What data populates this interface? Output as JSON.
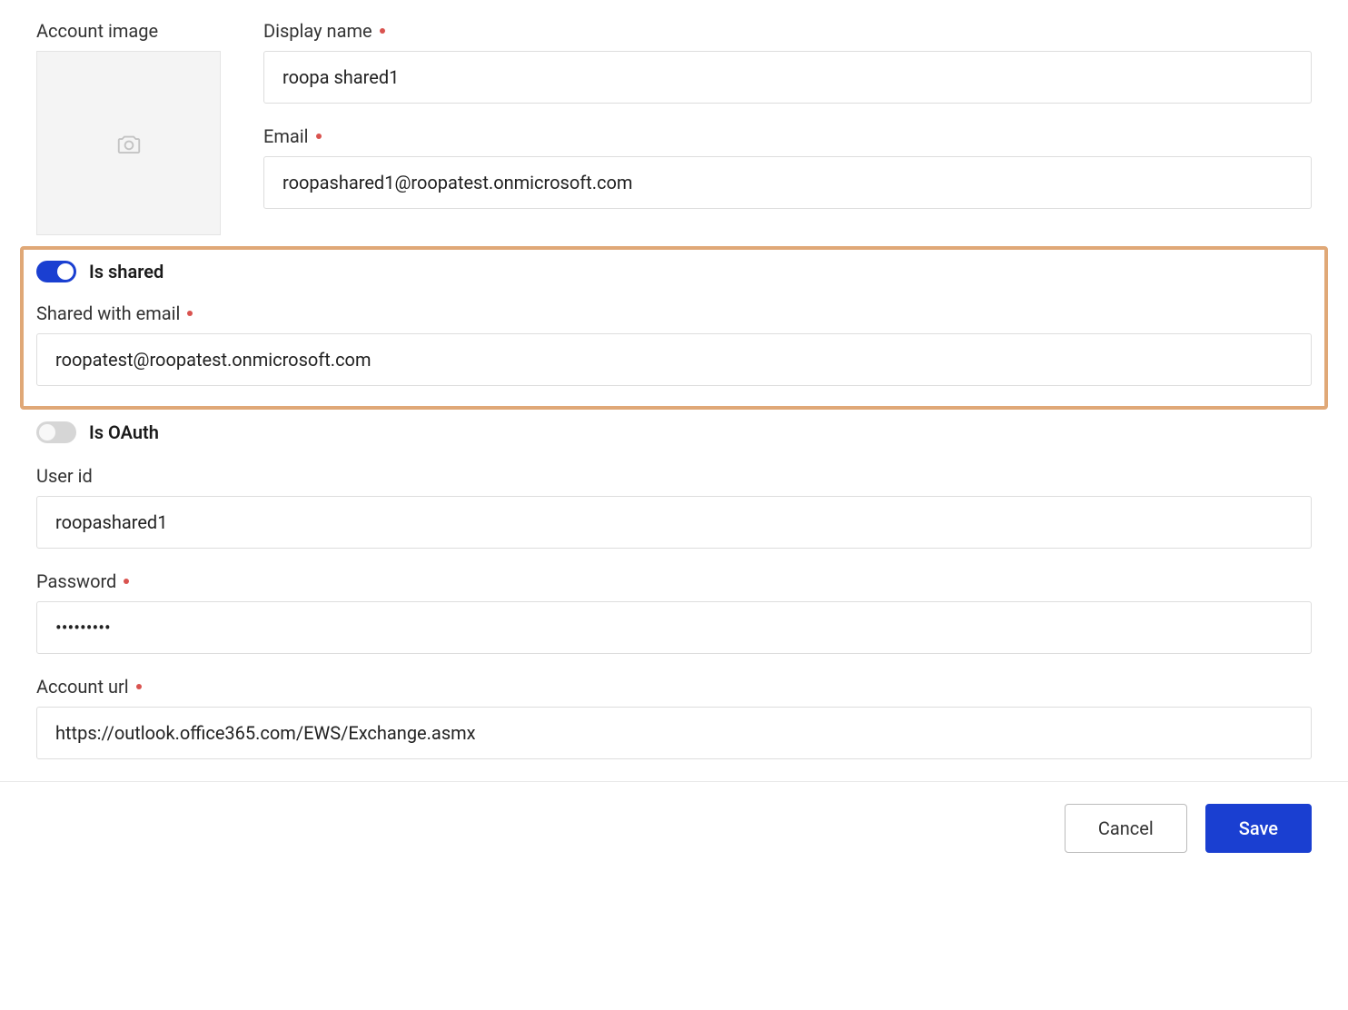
{
  "accountImage": {
    "label": "Account image"
  },
  "displayName": {
    "label": "Display name",
    "value": "roopa shared1",
    "required": true
  },
  "email": {
    "label": "Email",
    "value": "roopashared1@roopatest.onmicrosoft.com",
    "required": true
  },
  "isShared": {
    "label": "Is shared",
    "on": true
  },
  "sharedWithEmail": {
    "label": "Shared with email",
    "value": "roopatest@roopatest.onmicrosoft.com",
    "required": true
  },
  "isOAuth": {
    "label": "Is OAuth",
    "on": false
  },
  "userId": {
    "label": "User id",
    "value": "roopashared1",
    "required": false
  },
  "password": {
    "label": "Password",
    "value": "•••••••••",
    "required": true
  },
  "accountUrl": {
    "label": "Account url",
    "value": "https://outlook.office365.com/EWS/Exchange.asmx",
    "required": true
  },
  "buttons": {
    "cancel": "Cancel",
    "save": "Save"
  }
}
